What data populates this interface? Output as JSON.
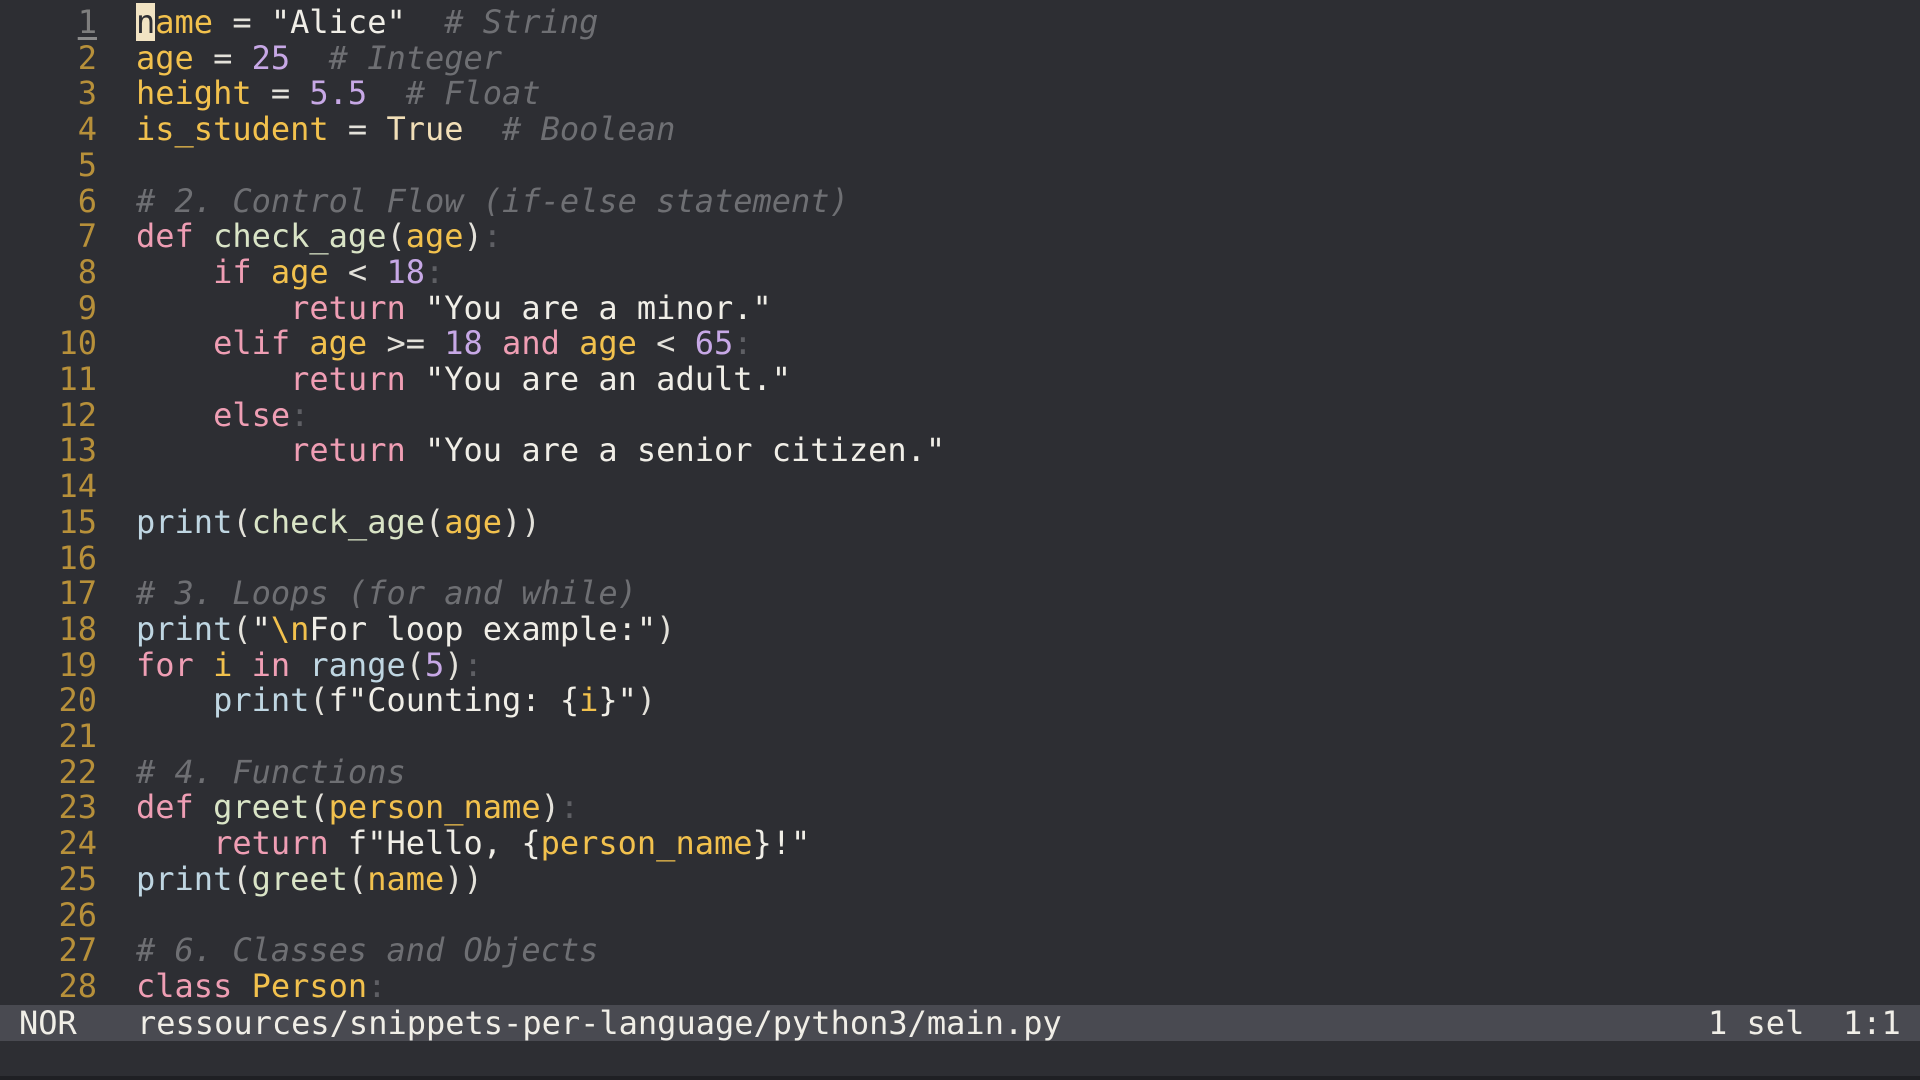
{
  "editor": {
    "lines": [
      {
        "num": "1",
        "cursor_char": "n",
        "tokens": [
          {
            "c": "var",
            "t": "ame"
          },
          {
            "c": "op",
            "t": " = "
          },
          {
            "c": "str",
            "t": "\"Alice\""
          },
          {
            "c": "op",
            "t": "  "
          },
          {
            "c": "com",
            "t": "# String"
          }
        ]
      },
      {
        "num": "2",
        "tokens": [
          {
            "c": "var",
            "t": "age"
          },
          {
            "c": "op",
            "t": " = "
          },
          {
            "c": "num",
            "t": "25"
          },
          {
            "c": "op",
            "t": "  "
          },
          {
            "c": "com",
            "t": "# Integer"
          }
        ]
      },
      {
        "num": "3",
        "tokens": [
          {
            "c": "var",
            "t": "height"
          },
          {
            "c": "op",
            "t": " = "
          },
          {
            "c": "num",
            "t": "5.5"
          },
          {
            "c": "op",
            "t": "  "
          },
          {
            "c": "com",
            "t": "# Float"
          }
        ]
      },
      {
        "num": "4",
        "tokens": [
          {
            "c": "var",
            "t": "is_student"
          },
          {
            "c": "op",
            "t": " = "
          },
          {
            "c": "bool",
            "t": "True"
          },
          {
            "c": "op",
            "t": "  "
          },
          {
            "c": "com",
            "t": "# Boolean"
          }
        ]
      },
      {
        "num": "5",
        "tokens": []
      },
      {
        "num": "6",
        "tokens": [
          {
            "c": "com",
            "t": "# 2. Control Flow (if-else statement)"
          }
        ]
      },
      {
        "num": "7",
        "tokens": [
          {
            "c": "kw",
            "t": "def"
          },
          {
            "c": "op",
            "t": " "
          },
          {
            "c": "fn",
            "t": "check_age"
          },
          {
            "c": "punc",
            "t": "("
          },
          {
            "c": "var",
            "t": "age"
          },
          {
            "c": "punc",
            "t": ")"
          },
          {
            "c": "colon",
            "t": ":"
          }
        ]
      },
      {
        "num": "8",
        "tokens": [
          {
            "c": "op",
            "t": "    "
          },
          {
            "c": "kw",
            "t": "if"
          },
          {
            "c": "op",
            "t": " "
          },
          {
            "c": "var",
            "t": "age"
          },
          {
            "c": "op",
            "t": " < "
          },
          {
            "c": "num",
            "t": "18"
          },
          {
            "c": "colon",
            "t": ":"
          }
        ]
      },
      {
        "num": "9",
        "tokens": [
          {
            "c": "op",
            "t": "        "
          },
          {
            "c": "kw",
            "t": "return"
          },
          {
            "c": "op",
            "t": " "
          },
          {
            "c": "str",
            "t": "\"You are a minor.\""
          }
        ]
      },
      {
        "num": "10",
        "tokens": [
          {
            "c": "op",
            "t": "    "
          },
          {
            "c": "kw",
            "t": "elif"
          },
          {
            "c": "op",
            "t": " "
          },
          {
            "c": "var",
            "t": "age"
          },
          {
            "c": "op",
            "t": " >= "
          },
          {
            "c": "num",
            "t": "18"
          },
          {
            "c": "op",
            "t": " "
          },
          {
            "c": "kw",
            "t": "and"
          },
          {
            "c": "op",
            "t": " "
          },
          {
            "c": "var",
            "t": "age"
          },
          {
            "c": "op",
            "t": " < "
          },
          {
            "c": "num",
            "t": "65"
          },
          {
            "c": "colon",
            "t": ":"
          }
        ]
      },
      {
        "num": "11",
        "tokens": [
          {
            "c": "op",
            "t": "        "
          },
          {
            "c": "kw",
            "t": "return"
          },
          {
            "c": "op",
            "t": " "
          },
          {
            "c": "str",
            "t": "\"You are an adult.\""
          }
        ]
      },
      {
        "num": "12",
        "tokens": [
          {
            "c": "op",
            "t": "    "
          },
          {
            "c": "kw",
            "t": "else"
          },
          {
            "c": "colon",
            "t": ":"
          }
        ]
      },
      {
        "num": "13",
        "tokens": [
          {
            "c": "op",
            "t": "        "
          },
          {
            "c": "kw",
            "t": "return"
          },
          {
            "c": "op",
            "t": " "
          },
          {
            "c": "str",
            "t": "\"You are a senior citizen.\""
          }
        ]
      },
      {
        "num": "14",
        "tokens": []
      },
      {
        "num": "15",
        "tokens": [
          {
            "c": "builtin",
            "t": "print"
          },
          {
            "c": "punc",
            "t": "("
          },
          {
            "c": "fn",
            "t": "check_age"
          },
          {
            "c": "punc",
            "t": "("
          },
          {
            "c": "var",
            "t": "age"
          },
          {
            "c": "punc",
            "t": "))"
          }
        ]
      },
      {
        "num": "16",
        "tokens": []
      },
      {
        "num": "17",
        "tokens": [
          {
            "c": "com",
            "t": "# 3. Loops (for and while)"
          }
        ]
      },
      {
        "num": "18",
        "tokens": [
          {
            "c": "builtin",
            "t": "print"
          },
          {
            "c": "punc",
            "t": "("
          },
          {
            "c": "str",
            "t": "\""
          },
          {
            "c": "esc",
            "t": "\\n"
          },
          {
            "c": "str",
            "t": "For loop example:\""
          },
          {
            "c": "punc",
            "t": ")"
          }
        ]
      },
      {
        "num": "19",
        "tokens": [
          {
            "c": "kw",
            "t": "for"
          },
          {
            "c": "op",
            "t": " "
          },
          {
            "c": "var",
            "t": "i"
          },
          {
            "c": "op",
            "t": " "
          },
          {
            "c": "kw",
            "t": "in"
          },
          {
            "c": "op",
            "t": " "
          },
          {
            "c": "builtin",
            "t": "range"
          },
          {
            "c": "punc",
            "t": "("
          },
          {
            "c": "num",
            "t": "5"
          },
          {
            "c": "punc",
            "t": ")"
          },
          {
            "c": "colon",
            "t": ":"
          }
        ]
      },
      {
        "num": "20",
        "tokens": [
          {
            "c": "op",
            "t": "    "
          },
          {
            "c": "builtin",
            "t": "print"
          },
          {
            "c": "punc",
            "t": "("
          },
          {
            "c": "str",
            "t": "f\"Counting: {"
          },
          {
            "c": "var",
            "t": "i"
          },
          {
            "c": "str",
            "t": "}\""
          },
          {
            "c": "punc",
            "t": ")"
          }
        ]
      },
      {
        "num": "21",
        "tokens": []
      },
      {
        "num": "22",
        "tokens": [
          {
            "c": "com",
            "t": "# 4. Functions"
          }
        ]
      },
      {
        "num": "23",
        "tokens": [
          {
            "c": "kw",
            "t": "def"
          },
          {
            "c": "op",
            "t": " "
          },
          {
            "c": "fn",
            "t": "greet"
          },
          {
            "c": "punc",
            "t": "("
          },
          {
            "c": "var",
            "t": "person_name"
          },
          {
            "c": "punc",
            "t": ")"
          },
          {
            "c": "colon",
            "t": ":"
          }
        ]
      },
      {
        "num": "24",
        "tokens": [
          {
            "c": "op",
            "t": "    "
          },
          {
            "c": "kw",
            "t": "return"
          },
          {
            "c": "op",
            "t": " "
          },
          {
            "c": "str",
            "t": "f\"Hello, {"
          },
          {
            "c": "var",
            "t": "person_name"
          },
          {
            "c": "str",
            "t": "}!\""
          }
        ]
      },
      {
        "num": "25",
        "tokens": [
          {
            "c": "builtin",
            "t": "print"
          },
          {
            "c": "punc",
            "t": "("
          },
          {
            "c": "fn",
            "t": "greet"
          },
          {
            "c": "punc",
            "t": "("
          },
          {
            "c": "var",
            "t": "name"
          },
          {
            "c": "punc",
            "t": "))"
          }
        ]
      },
      {
        "num": "26",
        "tokens": []
      },
      {
        "num": "27",
        "tokens": [
          {
            "c": "com",
            "t": "# 6. Classes and Objects"
          }
        ]
      },
      {
        "num": "28",
        "tokens": [
          {
            "c": "kw",
            "t": "class"
          },
          {
            "c": "op",
            "t": " "
          },
          {
            "c": "var",
            "t": "Person"
          },
          {
            "c": "colon",
            "t": ":"
          }
        ]
      }
    ]
  },
  "statusbar": {
    "mode": "NOR",
    "file_path": "ressources/snippets-per-language/python3/main.py",
    "selection": "1 sel",
    "position": "1:1"
  },
  "colors": {
    "background": "#2d2e33",
    "statusbar": "#494a51",
    "line_number": "#b7903a",
    "variable": "#f2c14d",
    "keyword": "#ef9eb4",
    "number": "#c7a8e6",
    "comment": "#6e6f73"
  }
}
